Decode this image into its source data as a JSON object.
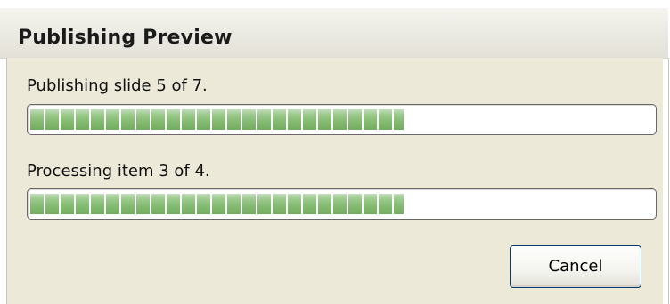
{
  "dialog": {
    "title": "Publishing Preview"
  },
  "publish_status": {
    "text": "Publishing slide 5 of 7.",
    "progress_fraction": 0.6
  },
  "process_status": {
    "text": "Processing item 3 of 4.",
    "progress_fraction": 0.6
  },
  "buttons": {
    "cancel_label": "Cancel"
  },
  "colors": {
    "progress_fill": "#86bd74",
    "dialog_background": "#ece9d8",
    "button_border": "#003c74"
  }
}
